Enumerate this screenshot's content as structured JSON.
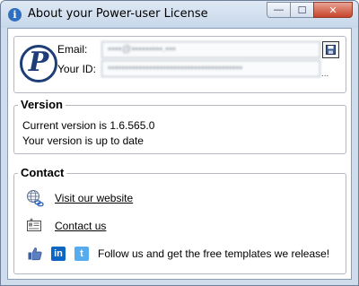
{
  "window": {
    "title": "About your Power-user License",
    "controls": {
      "minimize": "—",
      "maximize": "☐",
      "close": "✕"
    }
  },
  "user": {
    "email_label": "Email:",
    "email_value": "••••@•••••••••.•••",
    "id_label": "Your ID:",
    "id_value": "•••••••••••••••••••••••••••••••••••••••",
    "id_overflow": "..."
  },
  "version": {
    "legend": "Version",
    "current": "Current version is 1.6.565.0",
    "status": "Your version is up to date"
  },
  "contact": {
    "legend": "Contact",
    "website_link": "Visit our website",
    "contact_link": "Contact us",
    "follow_text": "Follow us and get the free templates we release!"
  },
  "icons": {
    "app": "info-icon",
    "logo": "power-user-logo",
    "save": "save-icon",
    "website": "globe-link-icon",
    "contact": "email-card-icon",
    "like": "thumbs-up-icon",
    "linkedin": "linkedin-icon",
    "twitter": "twitter-icon"
  }
}
